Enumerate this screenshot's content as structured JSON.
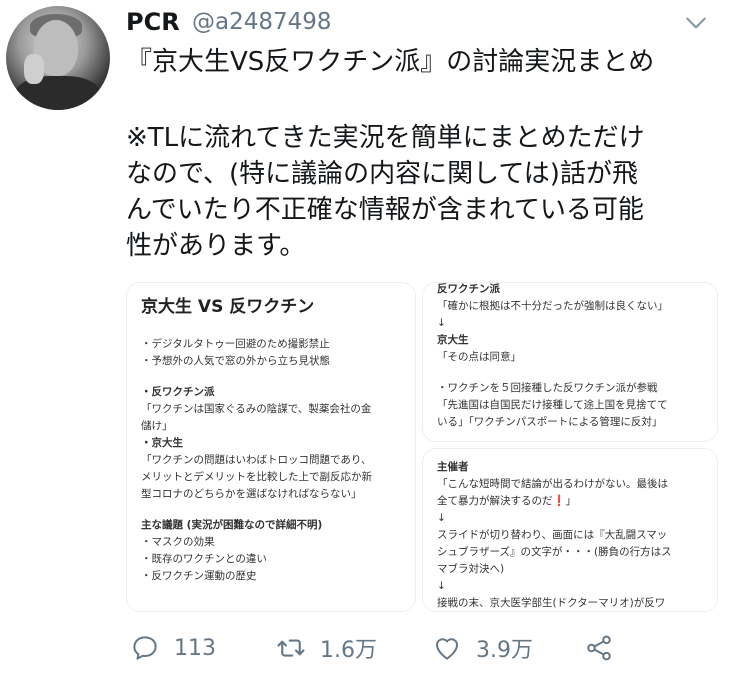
{
  "tweet": {
    "display_name": "PCR",
    "handle": "@a2487498",
    "text_lines": [
      "『京大生VS反ワクチン派』の討論実況まとめ",
      "",
      "※TLに流れてきた実況を簡単にまとめただけ",
      "なので、(特に議論の内容に関しては)話が飛",
      "んでいたり不正確な情報が含まれている可能",
      "性があります。"
    ]
  },
  "media": {
    "left": {
      "title": "京大生 VS 反ワクチン",
      "lines": [
        "・デジタルタトゥー回避のため撮影禁止",
        "・予想外の人気で窓の外から立ち見状態",
        "",
        "・反ワクチン派",
        "「ワクチンは国家ぐるみの陰謀で、製薬会社の金",
        "儲け」",
        "・京大生",
        "「ワクチンの問題はいわばトロッコ問題であり、",
        "メリットとデメリットを比較した上で副反応か新",
        "型コロナのどちらかを選ばなければならない」",
        "",
        "主な議題 (実況が困難なので詳細不明)",
        "・マスクの効果",
        "・既存のワクチンとの違い",
        "・反ワクチン運動の歴史"
      ],
      "bold_indices": [
        3,
        6,
        11
      ]
    },
    "right_top": {
      "lines": [
        "反ワクチン派",
        "「確かに根拠は不十分だったが強制は良くない」",
        "↓",
        "京大生",
        "「その点は同意」",
        "",
        "・ワクチンを５回接種した反ワクチン派が参戦",
        "「先進国は自国民だけ接種して途上国を見捨てて",
        "いる」「ワクチンパスポートによる管理に反対」"
      ],
      "bold_indices": [
        0,
        3
      ]
    },
    "right_bottom": {
      "lines": [
        "主催者",
        "「こんな短時間で結論が出るわけがない。最後は",
        "全て暴力が解決するのだ❗」",
        "↓",
        "スライドが切り替わり、画面には『大乱闘スマッ",
        "シュブラザーズ』の文字が・・・(勝負の行方はス",
        "マブラ対決へ)",
        "↓",
        "接戦の末、京大医学部生(ドクターマリオ)が反ワ"
      ],
      "bold_indices": [
        0
      ]
    }
  },
  "actions": {
    "reply": {
      "icon": "reply-icon",
      "count": "113"
    },
    "retweet": {
      "icon": "retweet-icon",
      "count": "1.6万"
    },
    "like": {
      "icon": "heart-icon",
      "count": "3.9万"
    },
    "share": {
      "icon": "share-icon"
    }
  },
  "colors": {
    "secondary_text": "#657786",
    "primary_text": "#14171a"
  }
}
